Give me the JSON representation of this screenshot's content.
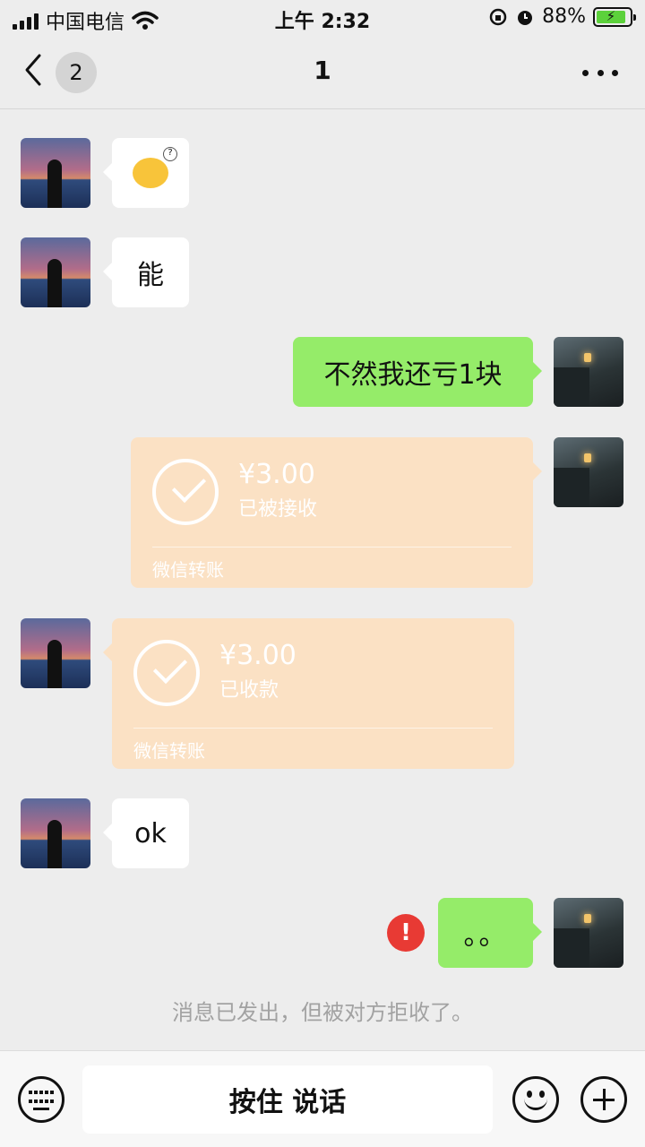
{
  "status_bar": {
    "carrier": "中国电信",
    "time": "上午 2:32",
    "battery_percent_label": "88%",
    "battery_level": 0.88
  },
  "nav": {
    "unread_count": "2",
    "title": "1"
  },
  "messages": [
    {
      "side": "in",
      "type": "emoji",
      "emoji_name": "thinking-face-emoji"
    },
    {
      "side": "in",
      "type": "text",
      "text": "能"
    },
    {
      "side": "out",
      "type": "text",
      "text": "不然我还亏1块"
    },
    {
      "side": "out",
      "type": "transfer",
      "amount": "¥3.00",
      "status": "已被接收",
      "footer": "微信转账"
    },
    {
      "side": "in",
      "type": "transfer",
      "amount": "¥3.00",
      "status": "已收款",
      "footer": "微信转账"
    },
    {
      "side": "in",
      "type": "text",
      "text": "ok"
    },
    {
      "side": "out",
      "type": "text",
      "text": "。。",
      "failed": true,
      "error_icon": "!"
    }
  ],
  "system_message": "消息已发出，但被对方拒收了。",
  "input_bar": {
    "hold_to_talk": "按住 说话"
  },
  "colors": {
    "background": "#ededed",
    "out_bubble": "#95ec69",
    "in_bubble": "#ffffff",
    "transfer_bubble": "#fbe1c4",
    "error": "#e83a34"
  }
}
